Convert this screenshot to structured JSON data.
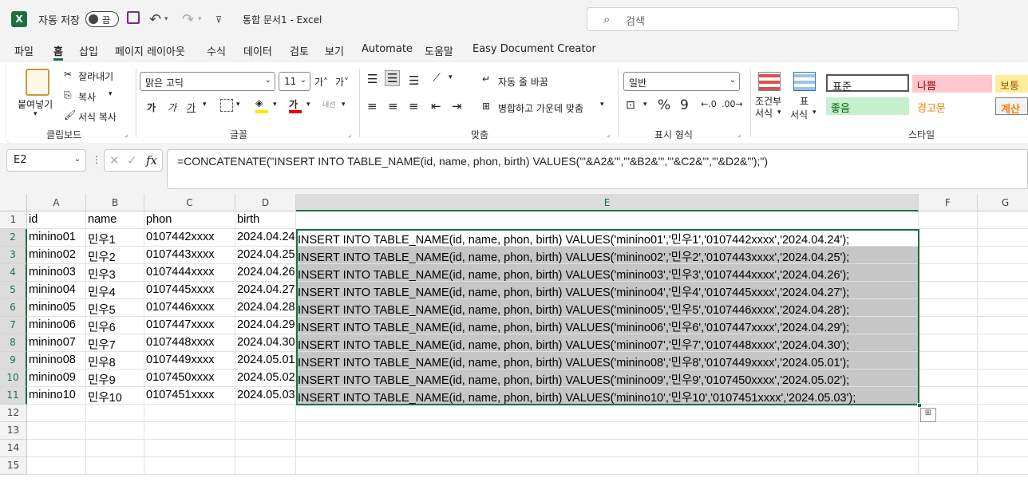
{
  "titlebar": {
    "logo": "X",
    "autosave_label": "자동 저장",
    "autosave_state": "끔",
    "doc_title": "통합 문서1  -  Excel",
    "search_placeholder": "검색"
  },
  "tabs": [
    "파일",
    "홈",
    "삽입",
    "페이지 레이아웃",
    "수식",
    "데이터",
    "검토",
    "보기",
    "Automate",
    "도움말",
    "Easy Document Creator"
  ],
  "active_tab": "홈",
  "ribbon": {
    "clipboard": {
      "paste": "붙여넣기",
      "cut": "잘라내기",
      "copy": "복사",
      "format_painter": "서식 복사",
      "label": "클립보드"
    },
    "font": {
      "name": "맑은 고딕",
      "size": "11",
      "bold": "가",
      "italic": "가",
      "underline": "가",
      "label": "글꼴",
      "grow": "가˄",
      "shrink": "가˅",
      "font_color": "가",
      "phonetic": "내선"
    },
    "alignment": {
      "wrap": "자동 줄 바꿈",
      "merge": "병합하고 가운데 맞춤",
      "label": "맞춤"
    },
    "number": {
      "format": "일반",
      "percent": "%",
      "comma": "9",
      "label": "표시 형식"
    },
    "styles": {
      "conditional": "조건부 서식",
      "conditional_l1": "조건부",
      "conditional_l2": "서식",
      "table": "표 서식",
      "table_l1": "표",
      "table_l2": "서식",
      "normal": "표준",
      "bad": "나쁨",
      "neutral": "보통",
      "good": "좋음",
      "warning": "경고문",
      "calc": "계산",
      "label": "스타일"
    }
  },
  "formula_bar": {
    "name_box": "E2",
    "formula": "=CONCATENATE(\"INSERT INTO TABLE_NAME(id, name, phon, birth) VALUES('\"&A2&\"','\"&B2&\"','\"&C2&\"','\"&D2&\"');\")"
  },
  "grid": {
    "columns": [
      "A",
      "B",
      "C",
      "D",
      "E",
      "F",
      "G"
    ],
    "selected_column": "E",
    "row_numbers": [
      "1",
      "2",
      "3",
      "4",
      "5",
      "6",
      "7",
      "8",
      "9",
      "10",
      "11",
      "12",
      "13",
      "14",
      "15"
    ],
    "header_row": [
      "id",
      "name",
      "phon",
      "birth"
    ],
    "rows": [
      [
        "minino01",
        "민우1",
        "0107442xxxx",
        "2024.04.24",
        "INSERT INTO TABLE_NAME(id, name, phon, birth) VALUES('minino01','민우1','0107442xxxx','2024.04.24');"
      ],
      [
        "minino02",
        "민우2",
        "0107443xxxx",
        "2024.04.25",
        "INSERT INTO TABLE_NAME(id, name, phon, birth) VALUES('minino02','민우2','0107443xxxx','2024.04.25');"
      ],
      [
        "minino03",
        "민우3",
        "0107444xxxx",
        "2024.04.26",
        "INSERT INTO TABLE_NAME(id, name, phon, birth) VALUES('minino03','민우3','0107444xxxx','2024.04.26');"
      ],
      [
        "minino04",
        "민우4",
        "0107445xxxx",
        "2024.04.27",
        "INSERT INTO TABLE_NAME(id, name, phon, birth) VALUES('minino04','민우4','0107445xxxx','2024.04.27');"
      ],
      [
        "minino05",
        "민우5",
        "0107446xxxx",
        "2024.04.28",
        "INSERT INTO TABLE_NAME(id, name, phon, birth) VALUES('minino05','민우5','0107446xxxx','2024.04.28');"
      ],
      [
        "minino06",
        "민우6",
        "0107447xxxx",
        "2024.04.29",
        "INSERT INTO TABLE_NAME(id, name, phon, birth) VALUES('minino06','민우6','0107447xxxx','2024.04.29');"
      ],
      [
        "minino07",
        "민우7",
        "0107448xxxx",
        "2024.04.30",
        "INSERT INTO TABLE_NAME(id, name, phon, birth) VALUES('minino07','민우7','0107448xxxx','2024.04.30');"
      ],
      [
        "minino08",
        "민우8",
        "0107449xxxx",
        "2024.05.01",
        "INSERT INTO TABLE_NAME(id, name, phon, birth) VALUES('minino08','민우8','0107449xxxx','2024.05.01');"
      ],
      [
        "minino09",
        "민우9",
        "0107450xxxx",
        "2024.05.02",
        "INSERT INTO TABLE_NAME(id, name, phon, birth) VALUES('minino09','민우9','0107450xxxx','2024.05.02');"
      ],
      [
        "minino10",
        "민우10",
        "0107451xxxx",
        "2024.05.03",
        "INSERT INTO TABLE_NAME(id, name, phon, birth) VALUES('minino10','민우10','0107451xxxx','2024.05.03');"
      ]
    ]
  },
  "colors": {
    "accent": "#1d6f42",
    "selection_shade": "#c6c6c6",
    "bad_bg": "#ffc7ce",
    "bad_fg": "#9c0006",
    "good_bg": "#c6efce",
    "good_fg": "#006100",
    "neutral_bg": "#ffeb9c",
    "neutral_fg": "#9c5700"
  }
}
